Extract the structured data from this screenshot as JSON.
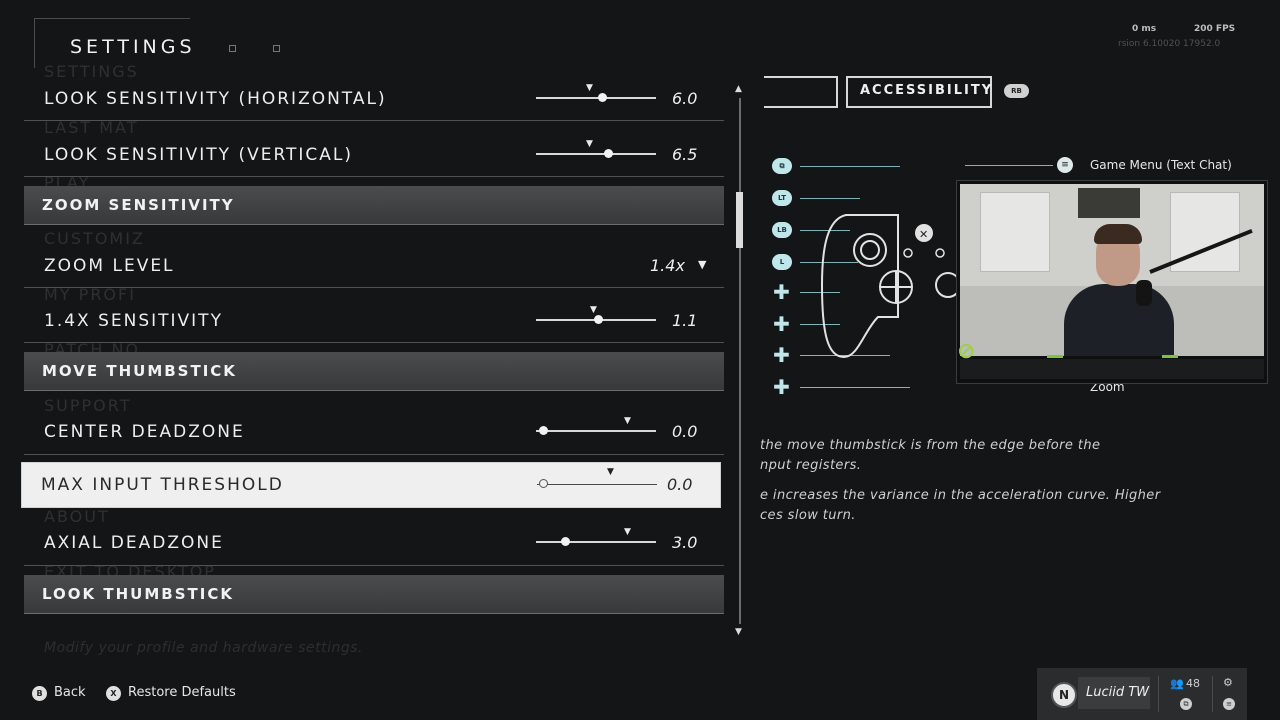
{
  "header": {
    "title": "SETTINGS",
    "latency": "0 ms",
    "fps": "200 FPS",
    "version": "rsion 6.10020 17952.0"
  },
  "ghost_menu": [
    "SETTINGS",
    "LAST MAT",
    "PLAY",
    "CUSTOMIZ",
    "MY PROFI",
    "PATCH NO",
    "SUPPORT",
    "ABOUT",
    "EXIT TO DESKTOP"
  ],
  "hint": "Modify your profile and hardware settings.",
  "settings": {
    "look_h": {
      "label": "LOOK SENSITIVITY (HORIZONTAL)",
      "value": "6.0",
      "fill": 0.55
    },
    "look_v": {
      "label": "LOOK SENSITIVITY (VERTICAL)",
      "value": "6.5",
      "fill": 0.6
    },
    "zoom_section": "ZOOM SENSITIVITY",
    "zoom_level": {
      "label": "ZOOM LEVEL",
      "value": "1.4x"
    },
    "sens_14": {
      "label": "1.4X SENSITIVITY",
      "value": "1.1",
      "fill": 0.52
    },
    "move_section": "MOVE THUMBSTICK",
    "center_dz": {
      "label": "CENTER DEADZONE",
      "value": "0.0",
      "fill": 0.06
    },
    "max_input": {
      "label": "MAX INPUT THRESHOLD",
      "value": "0.0",
      "fill": 0.05
    },
    "axial_dz": {
      "label": "AXIAL DEADZONE",
      "value": "3.0",
      "fill": 0.24
    },
    "look_section": "LOOK THUMBSTICK"
  },
  "tabs": {
    "accessibility": "ACCESSIBILITY",
    "rb": "RB"
  },
  "controller": {
    "icons": [
      "LT",
      "LB"
    ],
    "game_menu": "Game Menu (Text Chat)",
    "zoom": "Zoom"
  },
  "description": {
    "line1": "the move thumbstick is from the edge before the",
    "line2": "nput registers.",
    "line3": "e increases the variance in the acceleration curve. Higher",
    "line4": "ces slow turn."
  },
  "footer": {
    "back_key": "B",
    "back": "Back",
    "restore_key": "X",
    "restore": "Restore Defaults"
  },
  "profile": {
    "logo": "N",
    "name": "Luciid TW",
    "count": "48"
  },
  "colors": {
    "accent": "#bfe6ea",
    "selected_bg": "#efefef",
    "section_bg": "#444648"
  }
}
